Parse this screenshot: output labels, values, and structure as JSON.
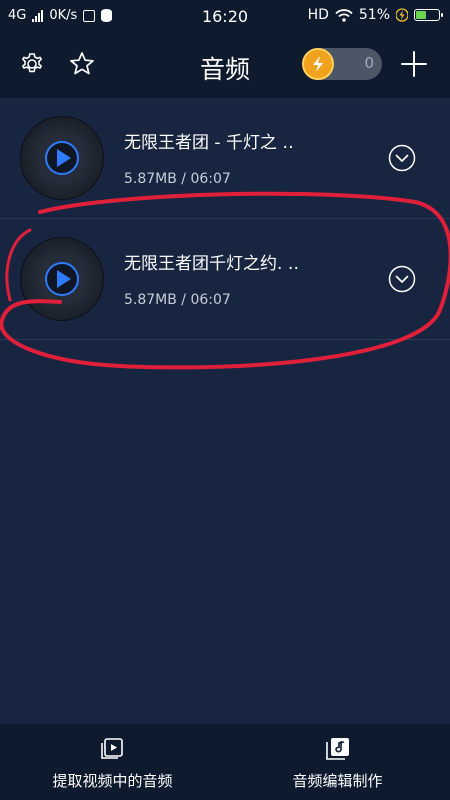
{
  "status_bar": {
    "network": "4G",
    "speed": "0K/s",
    "time": "16:20",
    "hd": "HD",
    "battery": "51%",
    "battery_fill": 0.51
  },
  "header": {
    "title": "音频",
    "coin_count": "0",
    "icons": [
      "gear-icon",
      "star-icon",
      "lightning-coin-icon",
      "plus-icon"
    ]
  },
  "list": [
    {
      "title": "无限王者团 - 千灯之 ‥",
      "meta": "5.87MB / 06:07"
    },
    {
      "title": "无限王者团千灯之约. ‥",
      "meta": "5.87MB / 06:07"
    }
  ],
  "bottom_nav": [
    {
      "label": "提取视频中的音频",
      "icon": "video-extract-icon"
    },
    {
      "label": "音频编辑制作",
      "icon": "music-edit-icon"
    }
  ],
  "colors": {
    "background": "#172540",
    "bar": "#0e1a2e",
    "accent": "#2f7bff",
    "coin": "#f0a21c",
    "annotation": "#e0203a"
  }
}
